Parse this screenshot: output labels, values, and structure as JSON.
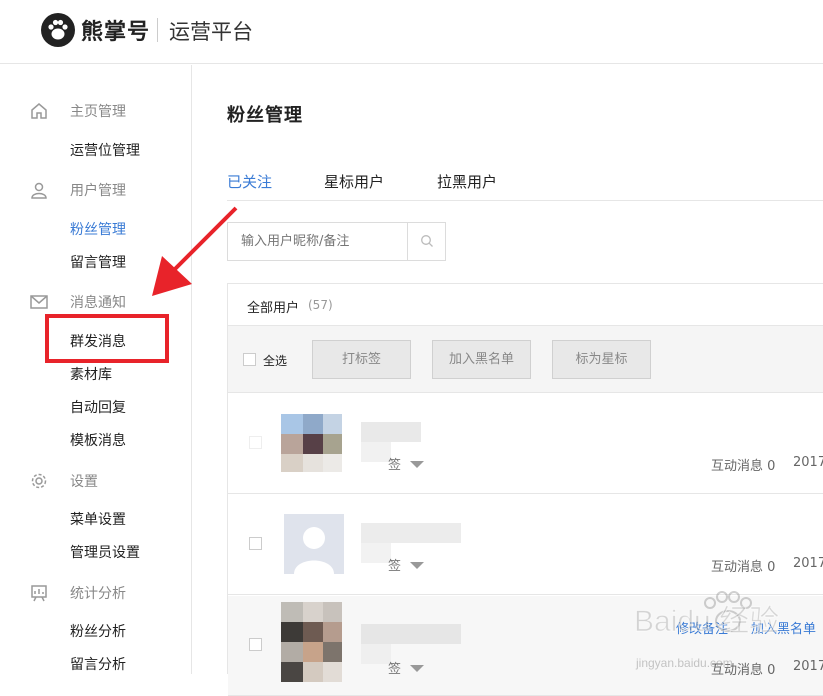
{
  "header": {
    "brand": "熊掌号",
    "platform": "运营平台"
  },
  "sidebar": {
    "groups": [
      {
        "title": "主页管理",
        "icon": "home-icon",
        "items": [
          "运营位管理"
        ]
      },
      {
        "title": "用户管理",
        "icon": "user-icon",
        "items": [
          "粉丝管理",
          "留言管理"
        ]
      },
      {
        "title": "消息通知",
        "icon": "mail-icon",
        "items": [
          "群发消息",
          "素材库",
          "自动回复",
          "模板消息"
        ]
      },
      {
        "title": "设置",
        "icon": "gear-icon",
        "items": [
          "菜单设置",
          "管理员设置"
        ]
      },
      {
        "title": "统计分析",
        "icon": "chart-icon",
        "items": [
          "粉丝分析",
          "留言分析"
        ]
      }
    ],
    "active_item": "粉丝管理"
  },
  "main": {
    "title": "粉丝管理",
    "tabs": [
      {
        "label": "已关注",
        "active": true
      },
      {
        "label": "星标用户",
        "active": false
      },
      {
        "label": "拉黑用户",
        "active": false
      }
    ],
    "search": {
      "placeholder": "输入用户昵称/备注"
    },
    "list": {
      "header_label": "全部用户",
      "header_count": "(57)",
      "select_all": "全选",
      "actions": [
        "打标签",
        "加入黑名单",
        "标为星标"
      ],
      "rows": [
        {
          "tag": "签",
          "stat": "互动消息 0",
          "date": "2017"
        },
        {
          "tag": "签",
          "stat": "互动消息 0",
          "date": "2017"
        },
        {
          "tag": "签",
          "stat": "互动消息 0",
          "date": "2017",
          "links": [
            "修改备注",
            "加入黑名单"
          ]
        }
      ]
    }
  },
  "watermark": {
    "text": "Baidu 经验",
    "url": "jingyan.baidu.com"
  },
  "colors": {
    "accent": "#3a7bd5",
    "highlight": "#e8232a"
  }
}
